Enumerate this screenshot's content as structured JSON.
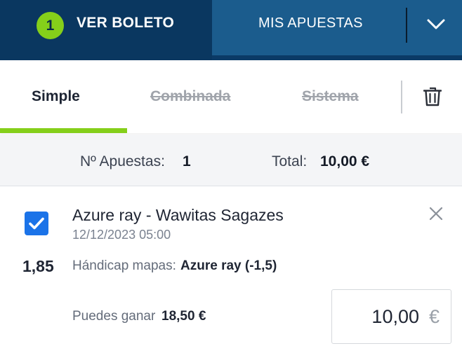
{
  "header": {
    "badge_count": "1",
    "ver_boleto_label": "VER BOLETO",
    "mis_apuestas_label": "MIS APUESTAS",
    "colors": {
      "primary": "#0a3760",
      "secondary": "#1b5c8d",
      "accent": "#85cf1a"
    }
  },
  "bet_tabs": {
    "simple": "Simple",
    "combinada": "Combinada",
    "sistema": "Sistema"
  },
  "summary": {
    "bets_label": "Nº Apuestas:",
    "bets_value": "1",
    "total_label": "Total:",
    "total_value": "10,00 €"
  },
  "bet": {
    "checked": true,
    "event": "Azure ray - Wawitas Sagazes",
    "datetime": "12/12/2023 05:00",
    "odds": "1,85",
    "market_label": "Hándicap mapas:",
    "selection": "Azure ray (-1,5)",
    "potential_win_label": "Puedes ganar",
    "potential_win_value": "18,50 €",
    "stake_value": "10,00",
    "stake_currency": "€"
  },
  "icons": {
    "chevron": "chevron-down-icon",
    "trash": "trash-icon",
    "close": "close-icon",
    "check": "checkmark-icon"
  }
}
